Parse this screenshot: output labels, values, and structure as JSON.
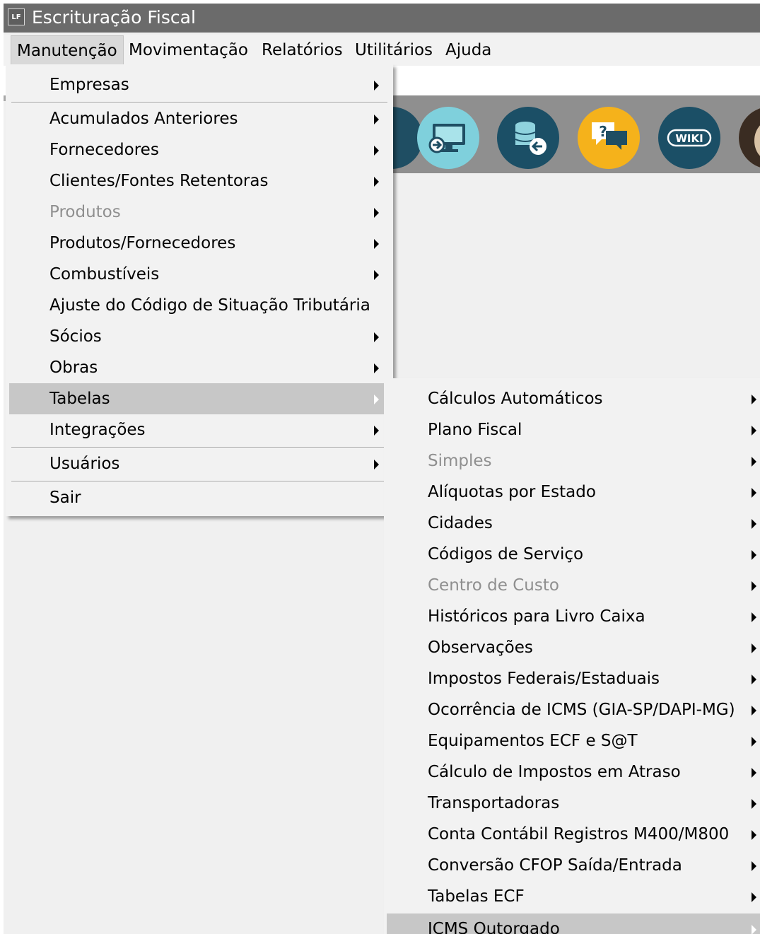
{
  "window": {
    "icon_text": "LF",
    "title": "Escrituração Fiscal"
  },
  "menubar": [
    "Manutenção",
    "Movimentação",
    "Relatórios",
    "Utilitários",
    "Ajuda"
  ],
  "toolbar_icons": [
    "remote-access-icon",
    "database-restore-icon",
    "help-chat-icon",
    "wiki-icon",
    "avatar"
  ],
  "toolbar_labels": {
    "wiki": "WIKI",
    "help": "?"
  },
  "manutencao_menu": [
    {
      "label": "Empresas",
      "submenu": true
    },
    {
      "label": "Acumulados Anteriores",
      "submenu": true
    },
    {
      "label": "Fornecedores",
      "submenu": true
    },
    {
      "label": "Clientes/Fontes Retentoras",
      "submenu": true
    },
    {
      "label": "Produtos",
      "submenu": true,
      "disabled": true
    },
    {
      "label": "Produtos/Fornecedores",
      "submenu": true
    },
    {
      "label": "Combustíveis",
      "submenu": true
    },
    {
      "label": "Ajuste do Código de Situação Tributária",
      "submenu": false
    },
    {
      "label": "Sócios",
      "submenu": true
    },
    {
      "label": "Obras",
      "submenu": true
    },
    {
      "label": "Tabelas",
      "submenu": true,
      "highlighted": true
    },
    {
      "label": "Integrações",
      "submenu": true
    },
    {
      "label": "Usuários",
      "submenu": true
    },
    {
      "label": "Sair",
      "submenu": false
    }
  ],
  "tabelas_menu": [
    {
      "label": "Cálculos Automáticos",
      "submenu": true
    },
    {
      "label": "Plano Fiscal",
      "submenu": true
    },
    {
      "label": "Simples",
      "submenu": true,
      "disabled": true
    },
    {
      "label": "Alíquotas por Estado",
      "submenu": true
    },
    {
      "label": "Cidades",
      "submenu": true
    },
    {
      "label": "Códigos de Serviço",
      "submenu": true
    },
    {
      "label": "Centro de Custo",
      "submenu": true,
      "disabled": true
    },
    {
      "label": "Históricos para Livro Caixa",
      "submenu": true
    },
    {
      "label": "Observações",
      "submenu": true
    },
    {
      "label": "Impostos Federais/Estaduais",
      "submenu": true
    },
    {
      "label": "Ocorrência de ICMS (GIA-SP/DAPI-MG)",
      "submenu": true
    },
    {
      "label": "Equipamentos ECF e S@T",
      "submenu": true
    },
    {
      "label": "Cálculo de Impostos em Atraso",
      "submenu": true
    },
    {
      "label": "Transportadoras",
      "submenu": true
    },
    {
      "label": "Conta Contábil Registros M400/M800",
      "submenu": true
    },
    {
      "label": "Conversão CFOP Saída/Entrada",
      "submenu": true
    },
    {
      "label": "Tabelas ECF",
      "submenu": true
    },
    {
      "label": "ICMS Outorgado",
      "submenu": true,
      "highlighted": true
    }
  ],
  "colors": {
    "titlebar": "#6b6b6b",
    "menu_bg": "#f2f2f2",
    "highlight": "#c7c7c7",
    "disabled_text": "#8f8f8f"
  }
}
